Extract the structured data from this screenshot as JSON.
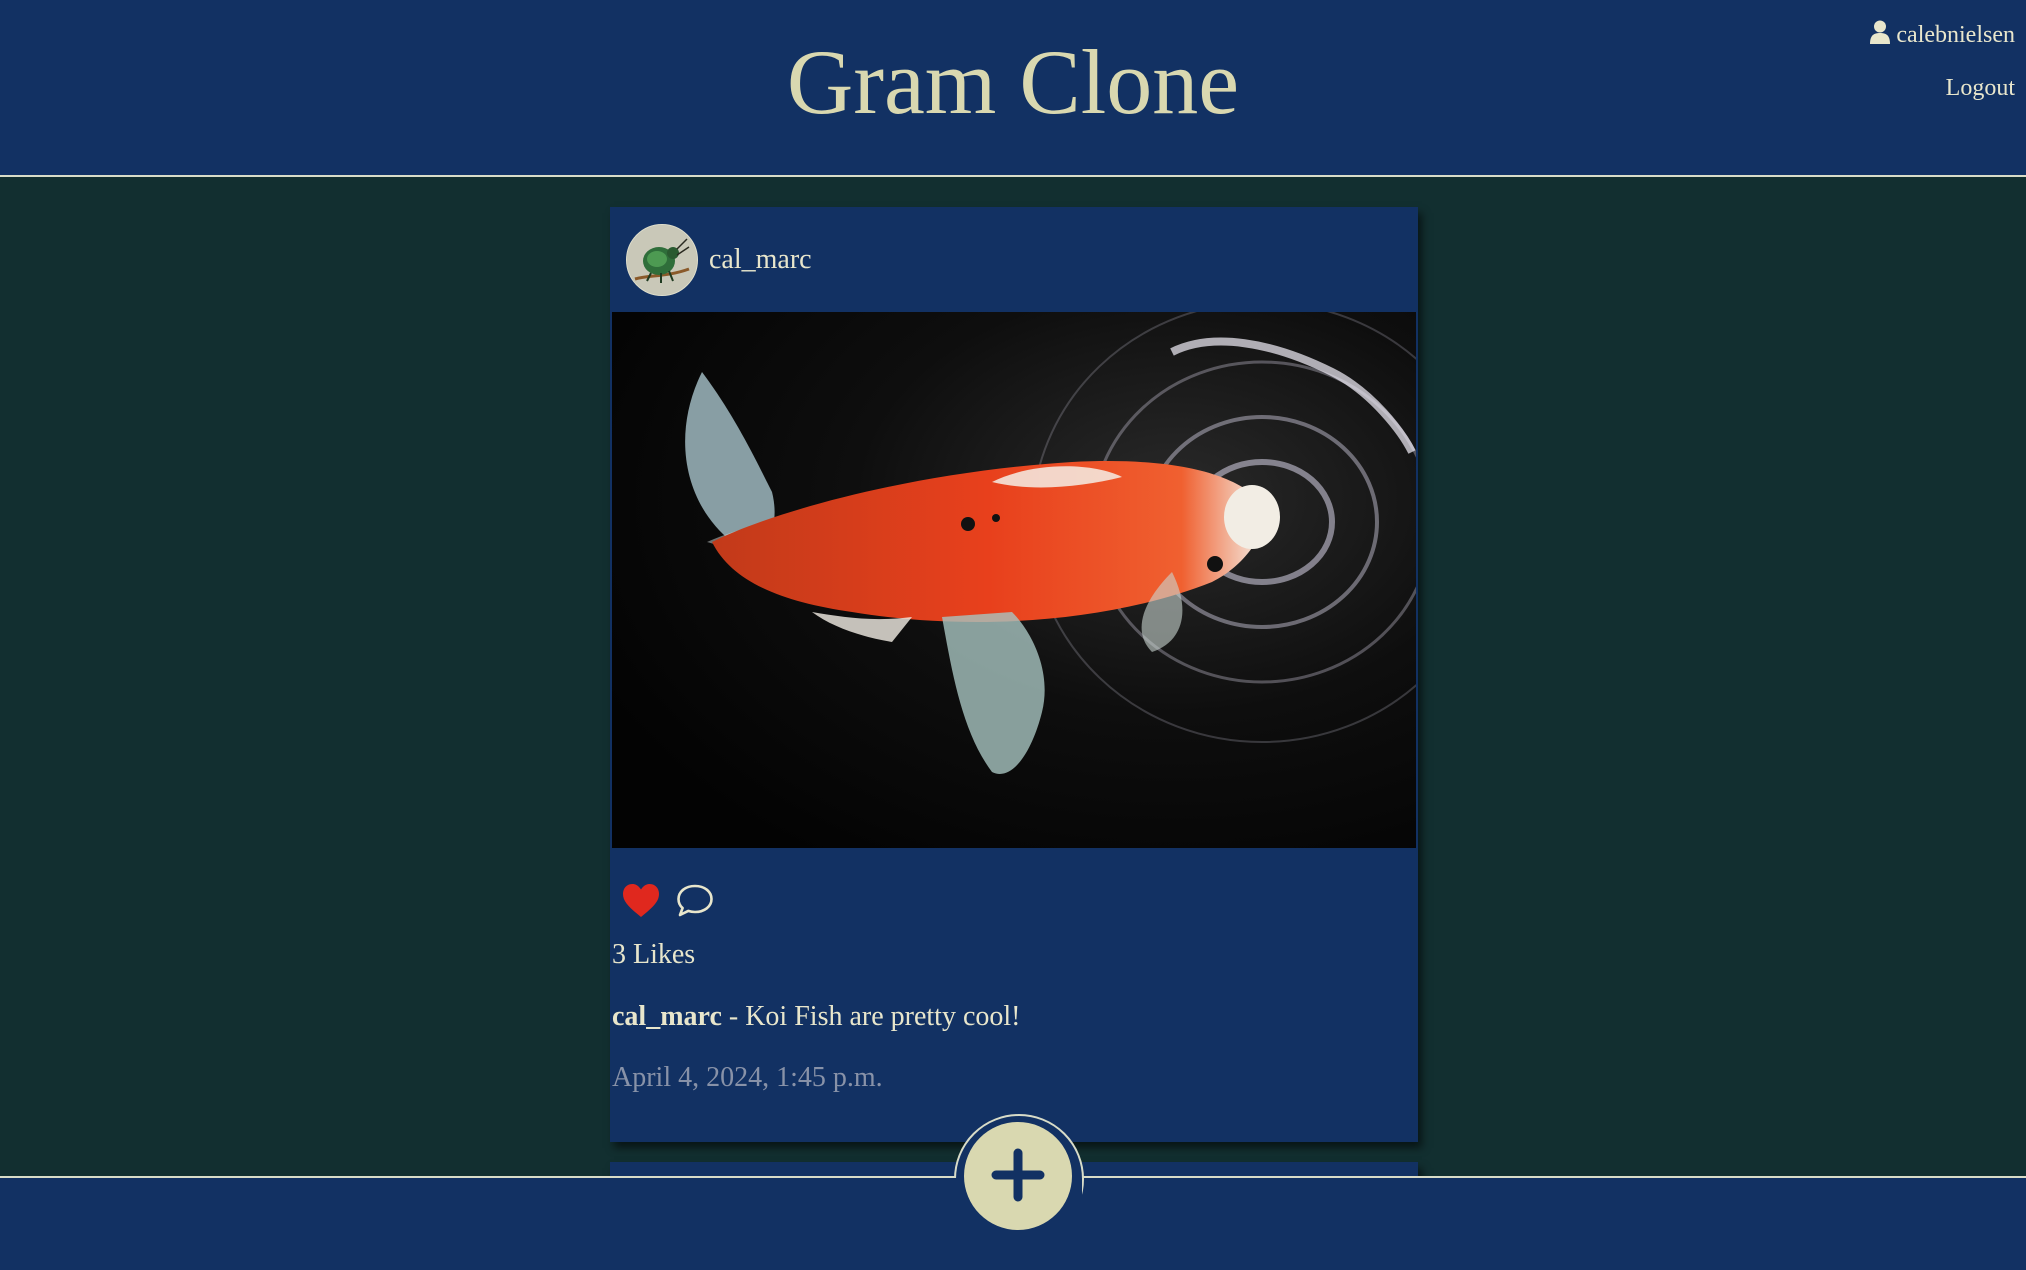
{
  "header": {
    "title": "Gram Clone",
    "username": "calebnielsen",
    "logout_label": "Logout"
  },
  "post": {
    "username": "cal_marc",
    "likes_text": "3 Likes",
    "caption_user": "cal_marc",
    "caption_text": " - Koi Fish are pretty cool!",
    "timestamp": "April 4, 2024, 1:45 p.m.",
    "liked": true
  },
  "icons": {
    "user": "user-icon",
    "like": "heart-icon",
    "comment": "comment-icon",
    "add": "plus-icon"
  },
  "colors": {
    "navy": "#123163",
    "dark_teal": "#122f30",
    "cream": "#d9d8b0",
    "like_red": "#e0281e"
  }
}
